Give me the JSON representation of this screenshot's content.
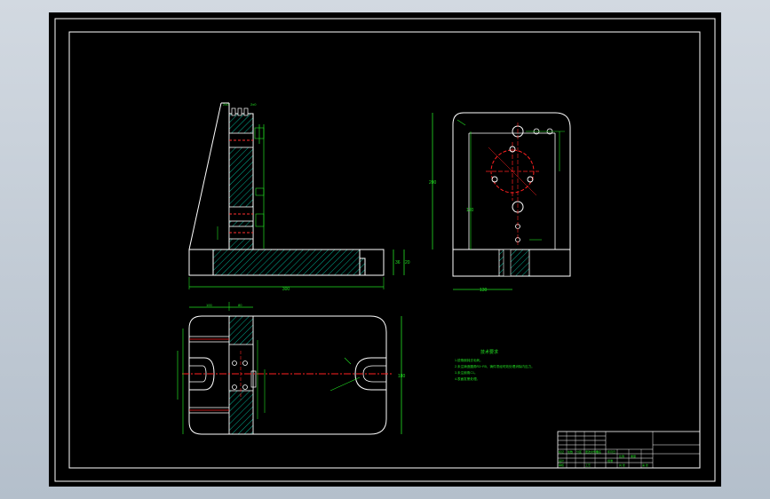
{
  "drawing": {
    "colors": {
      "background": "#000000",
      "frame": "#ffffff",
      "dimension": "#22e022",
      "centerline": "#ff2020",
      "outline": "#ffffff",
      "hatch": "#00c0a0"
    },
    "dimensions": {
      "front_bottom_width": "300",
      "front_height": "36",
      "front_height_right": "20",
      "top_width_a": "100",
      "top_width_b": "80",
      "top_right_height": "180",
      "right_height": "200",
      "right_inner_height": "120",
      "right_bottom_width": "130",
      "top_tag_left": "2x0",
      "top_tag_right": "2x0"
    },
    "notes": {
      "title": "技术要求",
      "lines": [
        "1.锐角倒钝去毛刺。",
        "2.未注铸造圆角R3~R5，铸件须经时效处理消除内应力。",
        "3.未注倒角C1。",
        "4.表面发黑处理。"
      ]
    },
    "title_block": {
      "cells": [
        "标记",
        "处数",
        "分区",
        "更改文件号",
        "签名",
        "年月日",
        "设计",
        "审核",
        "工艺",
        "批准",
        "比例",
        "重量",
        "共 张",
        "第 张"
      ]
    }
  }
}
